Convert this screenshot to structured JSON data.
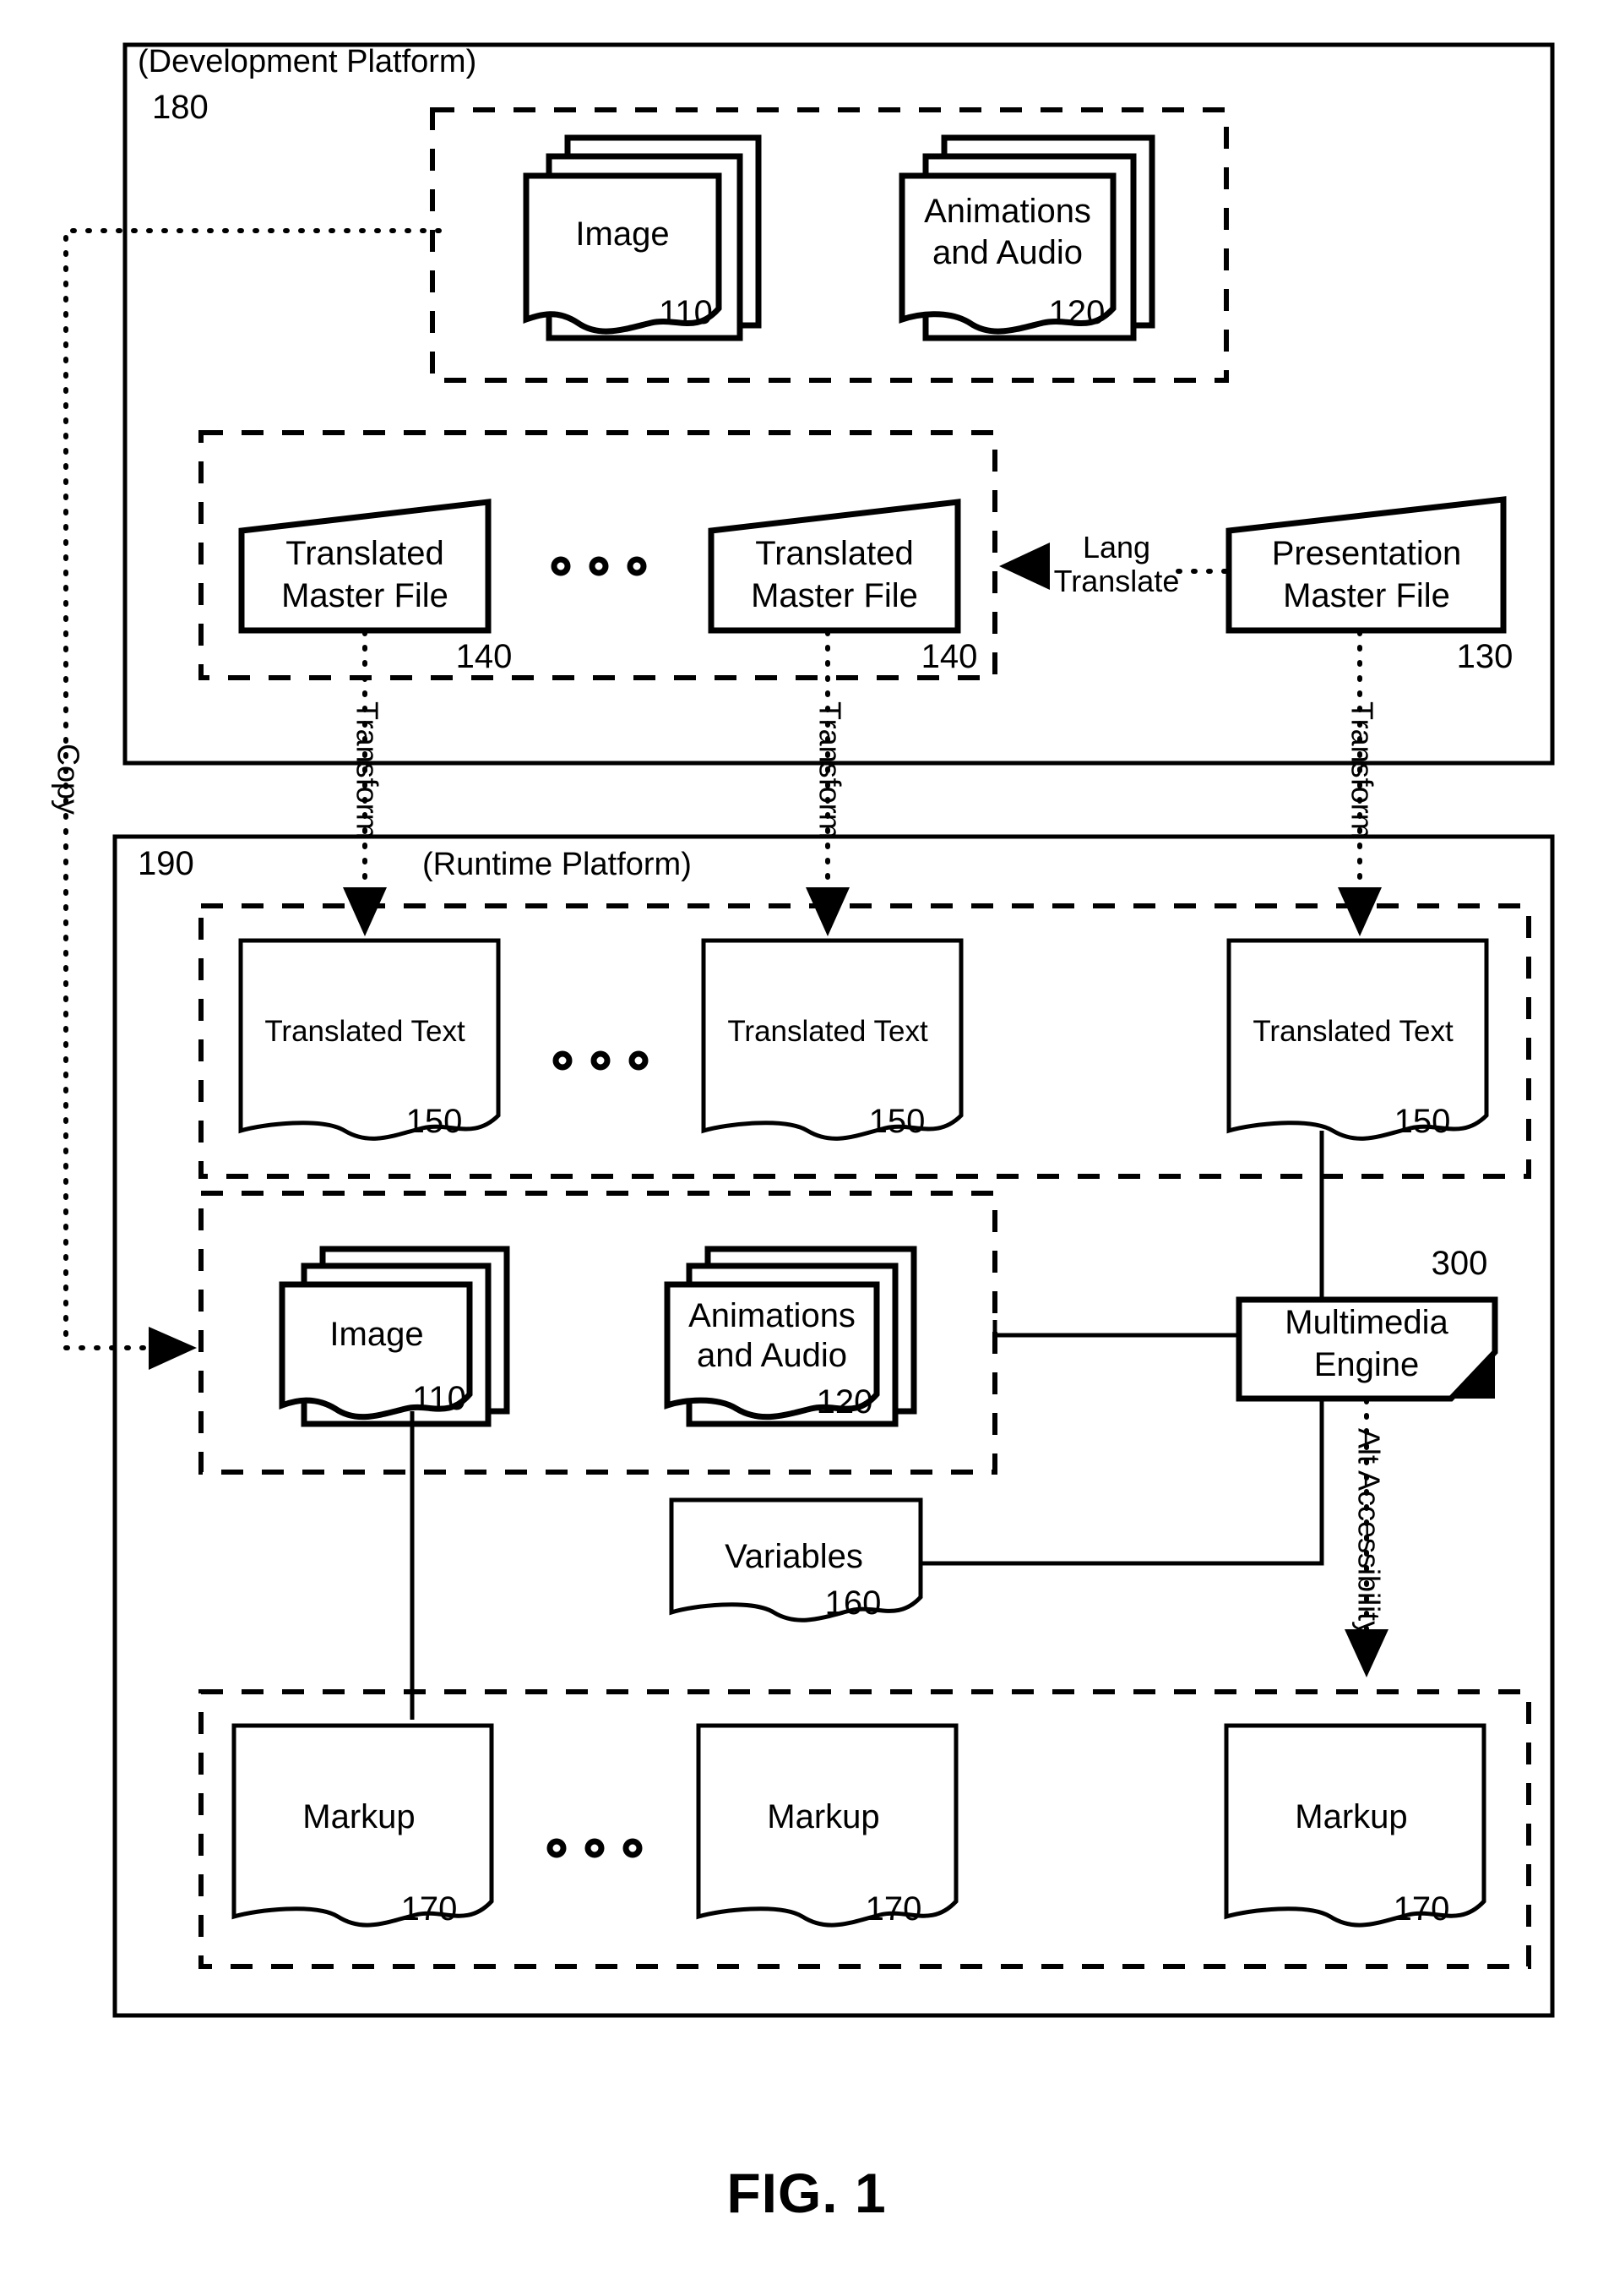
{
  "figure": {
    "caption": "FIG. 1",
    "platforms": [
      {
        "id": "dev",
        "title": "(Development Platform)",
        "ref": "180"
      },
      {
        "id": "runtime",
        "title": "(Runtime Platform)",
        "ref": "190"
      }
    ],
    "dev_assets": [
      {
        "label": "Image",
        "ref": "110",
        "shape": "stacked-document"
      },
      {
        "label": "Animations\nand Audio",
        "line1": "Animations",
        "line2": "and Audio",
        "ref": "120",
        "shape": "stacked-document"
      }
    ],
    "dev_master_files": [
      {
        "line1": "Translated",
        "line2": "Master File",
        "ref": "140",
        "shape": "trapezoid"
      },
      {
        "line1": "Translated",
        "line2": "Master File",
        "ref": "140",
        "shape": "trapezoid"
      },
      {
        "line1": "Presentation",
        "line2": "Master File",
        "ref": "130",
        "shape": "trapezoid"
      }
    ],
    "runtime_translated_text": [
      {
        "label": "Translated Text",
        "ref": "150",
        "shape": "document"
      },
      {
        "label": "Translated Text",
        "ref": "150",
        "shape": "document"
      },
      {
        "label": "Translated Text",
        "ref": "150",
        "shape": "document"
      }
    ],
    "runtime_assets": [
      {
        "label": "Image",
        "ref": "110",
        "shape": "stacked-document"
      },
      {
        "line1": "Animations",
        "line2": "and Audio",
        "ref": "120",
        "shape": "stacked-document"
      }
    ],
    "variables": {
      "label": "Variables",
      "ref": "160",
      "shape": "document"
    },
    "engine": {
      "line1": "Multimedia",
      "line2": "Engine",
      "ref": "300",
      "shape": "cut-corner-box"
    },
    "runtime_markup": [
      {
        "label": "Markup",
        "ref": "170",
        "shape": "document"
      },
      {
        "label": "Markup",
        "ref": "170",
        "shape": "document"
      },
      {
        "label": "Markup",
        "ref": "170",
        "shape": "document"
      }
    ],
    "edge_labels": {
      "copy": "Copy",
      "transform_1": "Transform",
      "transform_2": "Transform",
      "transform_3": "Transform",
      "lang_translate_line1": "Lang",
      "lang_translate_line2": "Translate",
      "alt_accessibility": "Alt Accessibility"
    },
    "ellipsis_glyph": "o o o"
  }
}
